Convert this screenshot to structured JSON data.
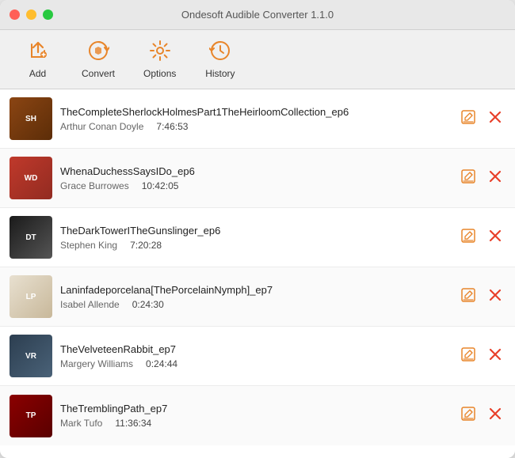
{
  "app": {
    "title": "Ondesoft Audible Converter 1.1.0"
  },
  "toolbar": {
    "add_label": "Add",
    "convert_label": "Convert",
    "options_label": "Options",
    "history_label": "History"
  },
  "books": [
    {
      "id": 1,
      "title": "TheCompleteSherlockHolmesPart1TheHeirloomCollection_ep6",
      "author": "Arthur Conan Doyle",
      "duration": "7:46:53",
      "cover_class": "cover-1",
      "cover_initials": "SH"
    },
    {
      "id": 2,
      "title": "WhenaDuchessSaysIDo_ep6",
      "author": "Grace Burrowes",
      "duration": "10:42:05",
      "cover_class": "cover-2",
      "cover_initials": "WD"
    },
    {
      "id": 3,
      "title": "TheDarkTowerITheGunslinger_ep6",
      "author": "Stephen King",
      "duration": "7:20:28",
      "cover_class": "cover-3",
      "cover_initials": "DT"
    },
    {
      "id": 4,
      "title": "Laninfadeporcelana[ThePorcelainNymph]_ep7",
      "author": "Isabel Allende",
      "duration": "0:24:30",
      "cover_class": "cover-4",
      "cover_initials": "LP"
    },
    {
      "id": 5,
      "title": "TheVelveteenRabbit_ep7",
      "author": "Margery Williams",
      "duration": "0:24:44",
      "cover_class": "cover-5",
      "cover_initials": "VR"
    },
    {
      "id": 6,
      "title": "TheTremblingPath_ep7",
      "author": "Mark Tufo",
      "duration": "11:36:34",
      "cover_class": "cover-6",
      "cover_initials": "TP"
    }
  ]
}
